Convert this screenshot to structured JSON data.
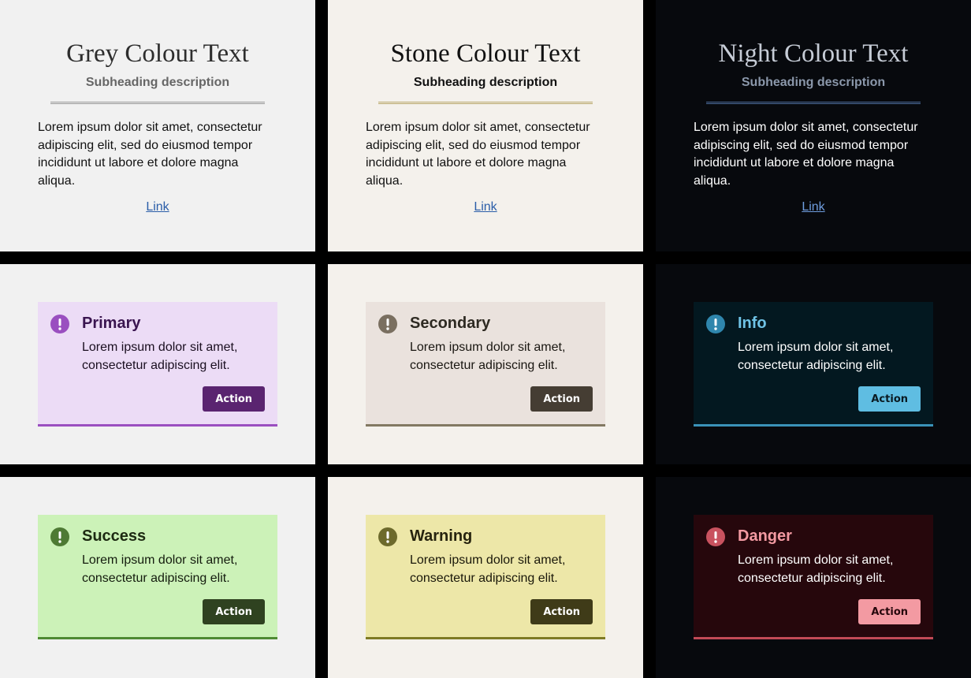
{
  "text_cards": [
    {
      "title": "Grey Colour Text",
      "subheading": "Subheading description",
      "body": "Lorem ipsum dolor sit amet, consectetur adipiscing elit, sed do eiusmod tempor incididunt ut labore et dolore magna aliqua.",
      "link": "Link"
    },
    {
      "title": "Stone Colour Text",
      "subheading": "Subheading description",
      "body": "Lorem ipsum dolor sit amet, consectetur adipiscing elit, sed do eiusmod tempor incididunt ut labore et dolore magna aliqua.",
      "link": "Link"
    },
    {
      "title": "Night Colour Text",
      "subheading": "Subheading description",
      "body": "Lorem ipsum dolor sit amet, consectetur adipiscing elit, sed do eiusmod tempor incididunt ut labore et dolore magna aliqua.",
      "link": "Link"
    }
  ],
  "alerts": [
    {
      "title": "Primary",
      "body": "Lorem ipsum dolor sit amet, consectetur adipiscing elit.",
      "button": "Action",
      "icon": "exclamation-circle-icon",
      "colors": {
        "bg": "#ecdcf6",
        "title": "#3a1550",
        "text": "#1a0f20",
        "icon": "#9a4fc0",
        "border": "#9a4fc0",
        "button_bg": "#5a2470",
        "button_text": "#ffffff"
      }
    },
    {
      "title": "Secondary",
      "body": "Lorem ipsum dolor sit amet, consectetur adipiscing elit.",
      "button": "Action",
      "icon": "exclamation-circle-icon",
      "colors": {
        "bg": "#eae2dd",
        "title": "#2e2a22",
        "text": "#1a1712",
        "icon": "#7a6f60",
        "border": "#827962",
        "button_bg": "#453d33",
        "button_text": "#ffffff"
      }
    },
    {
      "title": "Info",
      "body": "Lorem ipsum dolor sit amet, consectetur adipiscing elit.",
      "button": "Action",
      "icon": "exclamation-circle-icon",
      "colors": {
        "bg": "#031820",
        "title": "#6fc3e6",
        "text": "#ffffff",
        "icon": "#2f86ad",
        "border": "#3a92b8",
        "button_bg": "#5fbde2",
        "button_text": "#0a1a22"
      }
    },
    {
      "title": "Success",
      "body": "Lorem ipsum dolor sit amet, consectetur adipiscing elit.",
      "button": "Action",
      "icon": "exclamation-circle-icon",
      "colors": {
        "bg": "#ccf2b8",
        "title": "#1d2a12",
        "text": "#141c0e",
        "icon": "#4e7a34",
        "border": "#4f8a33",
        "button_bg": "#2f4220",
        "button_text": "#ffffff"
      }
    },
    {
      "title": "Warning",
      "body": "Lorem ipsum dolor sit amet, consectetur adipiscing elit.",
      "button": "Action",
      "icon": "exclamation-circle-icon",
      "colors": {
        "bg": "#ede7a8",
        "title": "#26230e",
        "text": "#1a180a",
        "icon": "#6d6a2c",
        "border": "#7e7a25",
        "button_bg": "#3f3b18",
        "button_text": "#ffffff"
      }
    },
    {
      "title": "Danger",
      "body": "Lorem ipsum dolor sit amet, consectetur adipiscing elit.",
      "button": "Action",
      "icon": "exclamation-circle-icon",
      "colors": {
        "bg": "#26070c",
        "title": "#f39aa2",
        "text": "#ffffff",
        "icon": "#c9525f",
        "border": "#c24a57",
        "button_bg": "#f39aa2",
        "button_text": "#26070c"
      }
    }
  ],
  "themes": {
    "grey": "#f1f1f1",
    "stone": "#f4f1ec",
    "night": "#07090d"
  }
}
